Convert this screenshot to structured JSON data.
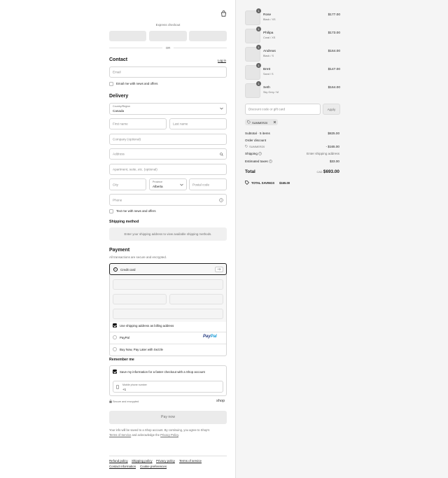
{
  "header": {
    "bag_icon": "shopping-bag-icon"
  },
  "express": {
    "title": "Express checkout",
    "or": "OR"
  },
  "contact": {
    "title": "Contact",
    "login": "Log in",
    "email_placeholder": "Email",
    "email_news": "Email me with news and offers"
  },
  "delivery": {
    "title": "Delivery",
    "country_label": "Country/Region",
    "country_value": "Canada",
    "first_name": "First name",
    "last_name": "Last name",
    "company": "Company (optional)",
    "address": "Address",
    "apartment": "Apartment, suite, etc. (optional)",
    "city": "City",
    "province_label": "Province",
    "province_value": "Alberta",
    "postal": "Postal code",
    "phone": "Phone",
    "text_news": "Text me with news and offers"
  },
  "shipping": {
    "title": "Shipping method",
    "message": "Enter your shipping address to view available shipping methods."
  },
  "payment": {
    "title": "Payment",
    "subtitle": "All transactions are secure and encrypted.",
    "credit_card": "Credit card",
    "more_badge": "+3",
    "billing_same": "Use shipping address as billing address",
    "paypal": "PayPal",
    "paypal_logo_a": "Pay",
    "paypal_logo_b": "Pal",
    "sezzle": "Buy Now, Pay Later with Sezzle"
  },
  "remember": {
    "title": "Remember me",
    "save_info": "Save my information for a faster checkout with a Shop account",
    "phone_label": "Mobile phone number",
    "phone_value": "+1",
    "secure": "Secure and encrypted",
    "shop_logo": "shop"
  },
  "pay_now": "Pay now",
  "disclaimer": {
    "text1": "Your info will be saved to a Shop account. By continuing, you agree to Shop's",
    "tos": "Terms of Service",
    "and": "and acknowledge the",
    "privacy": "Privacy Policy",
    "end": "."
  },
  "footer": {
    "refund": "Refund policy",
    "shipping": "Shipping policy",
    "privacy": "Privacy policy",
    "terms": "Terms of service",
    "contact": "Contact information",
    "cookies": "Cookie preferences"
  },
  "cart": {
    "items": [
      {
        "name": "Rose",
        "variant": "Black / XS",
        "price": "$177.00",
        "qty": "1"
      },
      {
        "name": "Philipa",
        "variant": "Coral / XS",
        "price": "$173.00",
        "qty": "1"
      },
      {
        "name": "Andreas",
        "variant": "Black / S",
        "price": "$164.00",
        "qty": "1"
      },
      {
        "name": "Brett",
        "variant": "Sand / S",
        "price": "$147.00",
        "qty": "1"
      },
      {
        "name": "Seth",
        "variant": "Sky Grey / M",
        "price": "$164.00",
        "qty": "1"
      }
    ],
    "discount_placeholder": "Discount code or gift card",
    "apply": "Apply",
    "code_tag": "SUMMER20",
    "subtotal_label": "Subtotal · 5 items",
    "subtotal_value": "$825.00",
    "order_discount_label": "Order discount",
    "order_discount_code": "SUMMER20",
    "order_discount_value": "- $165.00",
    "shipping_label": "Shipping",
    "shipping_value": "Enter shipping address",
    "taxes_label": "Estimated taxes",
    "taxes_value": "$33.00",
    "total_label": "Total",
    "total_currency": "CAD",
    "total_value": "$693.00",
    "savings_label": "TOTAL SAVINGS",
    "savings_value": "$165.00"
  }
}
